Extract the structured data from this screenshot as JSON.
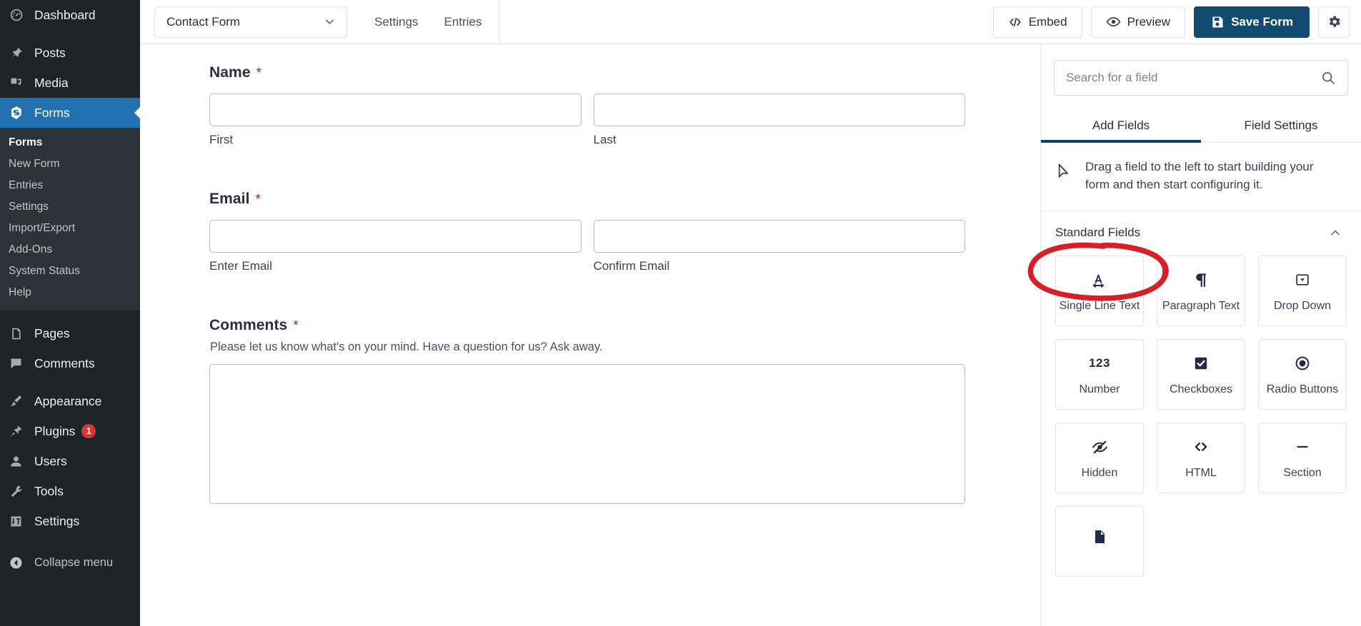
{
  "sidebar": {
    "items": [
      {
        "label": "Dashboard",
        "icon": "dashboard-icon",
        "name": "dashboard"
      },
      {
        "label": "Posts",
        "icon": "pin-icon",
        "name": "posts"
      },
      {
        "label": "Media",
        "icon": "media-icon",
        "name": "media"
      },
      {
        "label": "Forms",
        "icon": "forms-icon",
        "name": "forms",
        "active": true
      },
      {
        "label": "Pages",
        "icon": "pages-icon",
        "name": "pages"
      },
      {
        "label": "Comments",
        "icon": "comments-icon",
        "name": "comments"
      },
      {
        "label": "Appearance",
        "icon": "brush-icon",
        "name": "appearance"
      },
      {
        "label": "Plugins",
        "icon": "plug-icon",
        "name": "plugins",
        "badge": "1"
      },
      {
        "label": "Users",
        "icon": "user-icon",
        "name": "users"
      },
      {
        "label": "Tools",
        "icon": "wrench-icon",
        "name": "tools"
      },
      {
        "label": "Settings",
        "icon": "sliders-icon",
        "name": "settings"
      }
    ],
    "submenu": [
      {
        "label": "Forms",
        "current": true
      },
      {
        "label": "New Form"
      },
      {
        "label": "Entries"
      },
      {
        "label": "Settings"
      },
      {
        "label": "Import/Export"
      },
      {
        "label": "Add-Ons"
      },
      {
        "label": "System Status"
      },
      {
        "label": "Help"
      }
    ],
    "collapse_label": "Collapse menu",
    "collapse_icon": "collapse-arrow-icon",
    "accent_active": "#2271b1",
    "badge_color": "#d63638"
  },
  "toolbar": {
    "form_name": "Contact Form",
    "dropdown_icon": "chevron-down-icon",
    "tabs": [
      {
        "label": "Settings"
      },
      {
        "label": "Entries"
      }
    ],
    "embed_label": "Embed",
    "embed_icon": "code-brackets-icon",
    "preview_label": "Preview",
    "preview_icon": "eye-icon",
    "save_label": "Save Form",
    "save_icon": "floppy-disk-icon",
    "gear_icon": "gear-icon",
    "primary_color": "#124a70"
  },
  "canvas": {
    "required_mark": "*",
    "fields": [
      {
        "label": "Name",
        "required": true,
        "description": "",
        "type": "two-column",
        "columns": [
          {
            "sublabel": "First",
            "value": ""
          },
          {
            "sublabel": "Last",
            "value": ""
          }
        ]
      },
      {
        "label": "Email",
        "required": true,
        "description": "",
        "type": "two-column",
        "columns": [
          {
            "sublabel": "Enter Email",
            "value": ""
          },
          {
            "sublabel": "Confirm Email",
            "value": ""
          }
        ]
      },
      {
        "label": "Comments",
        "required": true,
        "description": "Please let us know what's on your mind. Have a question for us? Ask away.",
        "type": "textarea",
        "value": ""
      }
    ]
  },
  "panel": {
    "search": {
      "placeholder": "Search for a field",
      "value": "",
      "icon": "search-icon"
    },
    "tabs": [
      {
        "label": "Add Fields",
        "active": true
      },
      {
        "label": "Field Settings",
        "active": false
      }
    ],
    "hint": {
      "icon": "cursor-arrow-icon",
      "text": "Drag a field to the left to start building your form and then start configuring it."
    },
    "section": {
      "title": "Standard Fields",
      "collapse_icon": "chevron-up-icon",
      "expanded": true
    },
    "fields": [
      {
        "label": "Single Line Text",
        "icon": "text-width-icon"
      },
      {
        "label": "Paragraph Text",
        "icon": "pilcrow-icon"
      },
      {
        "label": "Drop Down",
        "icon": "dropdown-box-icon"
      },
      {
        "label": "Number",
        "icon": "number-123-icon"
      },
      {
        "label": "Checkboxes",
        "icon": "checkbox-checked-icon"
      },
      {
        "label": "Radio Buttons",
        "icon": "radio-selected-icon"
      },
      {
        "label": "Hidden",
        "icon": "eye-slash-icon"
      },
      {
        "label": "HTML",
        "icon": "angle-brackets-icon"
      },
      {
        "label": "Section",
        "icon": "dash-icon"
      },
      {
        "label": "",
        "icon": "page-break-icon"
      }
    ],
    "active_tab_underline": "#0e3f62"
  },
  "annotation": {
    "type": "hand-drawn-ellipse",
    "target": "Standard Fields",
    "color": "#d61f26"
  }
}
